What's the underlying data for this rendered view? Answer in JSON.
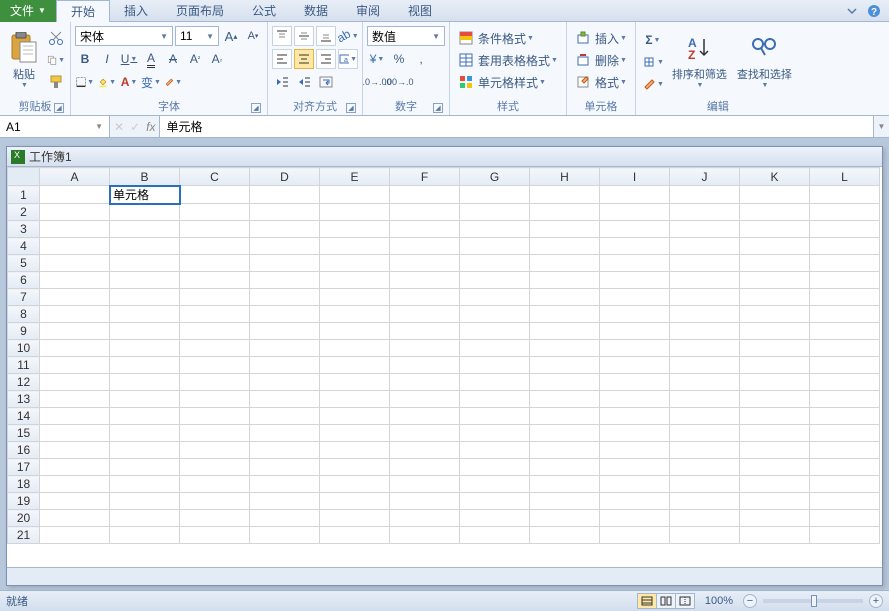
{
  "tabs": {
    "file": "文件",
    "items": [
      "开始",
      "插入",
      "页面布局",
      "公式",
      "数据",
      "审阅",
      "视图"
    ],
    "active_index": 0
  },
  "ribbon": {
    "clipboard": {
      "label": "剪贴板",
      "paste": "粘贴"
    },
    "font": {
      "label": "字体",
      "name": "宋体",
      "size": "11"
    },
    "alignment": {
      "label": "对齐方式"
    },
    "number": {
      "label": "数字",
      "format": "数值"
    },
    "styles": {
      "label": "样式",
      "conditional": "条件格式",
      "table_format": "套用表格格式",
      "cell_styles": "单元格样式"
    },
    "cells": {
      "label": "单元格",
      "insert": "插入",
      "delete": "删除",
      "format": "格式"
    },
    "editing": {
      "label": "编辑",
      "sort_filter": "排序和筛选",
      "find_select": "查找和选择"
    }
  },
  "formula_bar": {
    "name_box": "A1",
    "fx": "fx",
    "value": "单元格"
  },
  "workbook": {
    "title": "工作簿1"
  },
  "grid": {
    "columns": [
      "A",
      "B",
      "C",
      "D",
      "E",
      "F",
      "G",
      "H",
      "I",
      "J",
      "K",
      "L"
    ],
    "rows": [
      1,
      2,
      3,
      4,
      5,
      6,
      7,
      8,
      9,
      10,
      11,
      12,
      13,
      14,
      15,
      16,
      17,
      18,
      19,
      20,
      21
    ],
    "selected_cell": "B1",
    "cell_B1": "单元格",
    "page_break_after_col": "I"
  },
  "status": {
    "state": "就绪",
    "zoom": "100%"
  },
  "chart_data": null
}
